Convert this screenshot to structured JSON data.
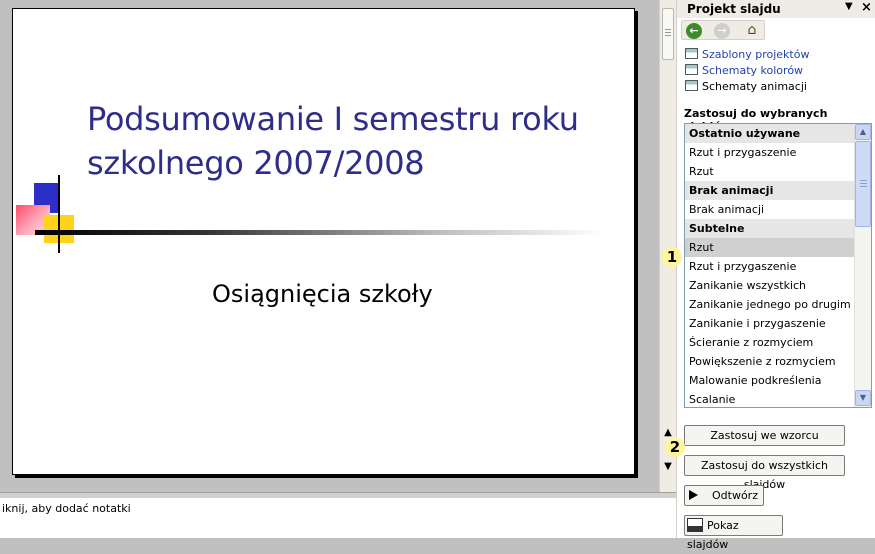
{
  "slide": {
    "title": "Podsumowanie I semestru roku szkolnego 2007/2008",
    "subtitle": "Osiągnięcia szkoły"
  },
  "notes": {
    "placeholder": "iknij, aby dodać notatki"
  },
  "editor_nav": {
    "prev_icon": "double-up-arrow-icon",
    "next_icon": "double-down-arrow-icon"
  },
  "taskpane": {
    "title": "Projekt slajdu",
    "links": [
      {
        "label": "Szablony projektów",
        "icon": "design-templates-icon"
      },
      {
        "label": "Schematy kolorów",
        "icon": "color-schemes-icon"
      },
      {
        "label": "Schematy animacji",
        "icon": "animation-schemes-icon"
      }
    ],
    "apply_label": "Zastosuj do wybranych slajdów:",
    "list": [
      {
        "label": "Ostatnio używane",
        "kind": "header"
      },
      {
        "label": "Rzut i przygaszenie",
        "kind": "item"
      },
      {
        "label": "Rzut",
        "kind": "item"
      },
      {
        "label": "Brak animacji",
        "kind": "header"
      },
      {
        "label": "Brak animacji",
        "kind": "item"
      },
      {
        "label": "Subtelne",
        "kind": "header"
      },
      {
        "label": "Rzut",
        "kind": "selected"
      },
      {
        "label": "Rzut i przygaszenie",
        "kind": "item"
      },
      {
        "label": "Zanikanie wszystkich",
        "kind": "item"
      },
      {
        "label": "Zanikanie jednego po drugim",
        "kind": "item"
      },
      {
        "label": "Zanikanie i przygaszenie",
        "kind": "item"
      },
      {
        "label": "Ścieranie z rozmyciem",
        "kind": "item"
      },
      {
        "label": "Powiększenie z rozmyciem",
        "kind": "item"
      },
      {
        "label": "Malowanie podkreślenia",
        "kind": "item"
      },
      {
        "label": "Scalanie",
        "kind": "item"
      }
    ],
    "buttons": {
      "apply_master": "Zastosuj we wzorcu",
      "apply_all": "Zastosuj do wszystkich slajdów",
      "play": "Odtwórz",
      "slideshow": "Pokaz slajdów"
    }
  },
  "callouts": {
    "one": "1",
    "two": "2"
  },
  "colors": {
    "title_text": "#2e2e8a",
    "link": "#2244aa",
    "callout": "#fff59b"
  }
}
